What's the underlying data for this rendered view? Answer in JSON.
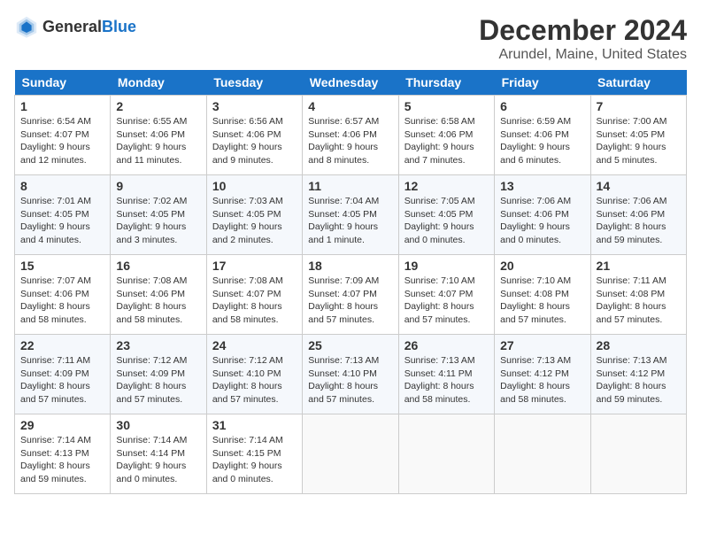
{
  "header": {
    "logo_general": "General",
    "logo_blue": "Blue",
    "month": "December 2024",
    "location": "Arundel, Maine, United States"
  },
  "weekdays": [
    "Sunday",
    "Monday",
    "Tuesday",
    "Wednesday",
    "Thursday",
    "Friday",
    "Saturday"
  ],
  "weeks": [
    [
      {
        "day": "1",
        "sunrise": "Sunrise: 6:54 AM",
        "sunset": "Sunset: 4:07 PM",
        "daylight": "Daylight: 9 hours and 12 minutes."
      },
      {
        "day": "2",
        "sunrise": "Sunrise: 6:55 AM",
        "sunset": "Sunset: 4:06 PM",
        "daylight": "Daylight: 9 hours and 11 minutes."
      },
      {
        "day": "3",
        "sunrise": "Sunrise: 6:56 AM",
        "sunset": "Sunset: 4:06 PM",
        "daylight": "Daylight: 9 hours and 9 minutes."
      },
      {
        "day": "4",
        "sunrise": "Sunrise: 6:57 AM",
        "sunset": "Sunset: 4:06 PM",
        "daylight": "Daylight: 9 hours and 8 minutes."
      },
      {
        "day": "5",
        "sunrise": "Sunrise: 6:58 AM",
        "sunset": "Sunset: 4:06 PM",
        "daylight": "Daylight: 9 hours and 7 minutes."
      },
      {
        "day": "6",
        "sunrise": "Sunrise: 6:59 AM",
        "sunset": "Sunset: 4:06 PM",
        "daylight": "Daylight: 9 hours and 6 minutes."
      },
      {
        "day": "7",
        "sunrise": "Sunrise: 7:00 AM",
        "sunset": "Sunset: 4:05 PM",
        "daylight": "Daylight: 9 hours and 5 minutes."
      }
    ],
    [
      {
        "day": "8",
        "sunrise": "Sunrise: 7:01 AM",
        "sunset": "Sunset: 4:05 PM",
        "daylight": "Daylight: 9 hours and 4 minutes."
      },
      {
        "day": "9",
        "sunrise": "Sunrise: 7:02 AM",
        "sunset": "Sunset: 4:05 PM",
        "daylight": "Daylight: 9 hours and 3 minutes."
      },
      {
        "day": "10",
        "sunrise": "Sunrise: 7:03 AM",
        "sunset": "Sunset: 4:05 PM",
        "daylight": "Daylight: 9 hours and 2 minutes."
      },
      {
        "day": "11",
        "sunrise": "Sunrise: 7:04 AM",
        "sunset": "Sunset: 4:05 PM",
        "daylight": "Daylight: 9 hours and 1 minute."
      },
      {
        "day": "12",
        "sunrise": "Sunrise: 7:05 AM",
        "sunset": "Sunset: 4:05 PM",
        "daylight": "Daylight: 9 hours and 0 minutes."
      },
      {
        "day": "13",
        "sunrise": "Sunrise: 7:06 AM",
        "sunset": "Sunset: 4:06 PM",
        "daylight": "Daylight: 9 hours and 0 minutes."
      },
      {
        "day": "14",
        "sunrise": "Sunrise: 7:06 AM",
        "sunset": "Sunset: 4:06 PM",
        "daylight": "Daylight: 8 hours and 59 minutes."
      }
    ],
    [
      {
        "day": "15",
        "sunrise": "Sunrise: 7:07 AM",
        "sunset": "Sunset: 4:06 PM",
        "daylight": "Daylight: 8 hours and 58 minutes."
      },
      {
        "day": "16",
        "sunrise": "Sunrise: 7:08 AM",
        "sunset": "Sunset: 4:06 PM",
        "daylight": "Daylight: 8 hours and 58 minutes."
      },
      {
        "day": "17",
        "sunrise": "Sunrise: 7:08 AM",
        "sunset": "Sunset: 4:07 PM",
        "daylight": "Daylight: 8 hours and 58 minutes."
      },
      {
        "day": "18",
        "sunrise": "Sunrise: 7:09 AM",
        "sunset": "Sunset: 4:07 PM",
        "daylight": "Daylight: 8 hours and 57 minutes."
      },
      {
        "day": "19",
        "sunrise": "Sunrise: 7:10 AM",
        "sunset": "Sunset: 4:07 PM",
        "daylight": "Daylight: 8 hours and 57 minutes."
      },
      {
        "day": "20",
        "sunrise": "Sunrise: 7:10 AM",
        "sunset": "Sunset: 4:08 PM",
        "daylight": "Daylight: 8 hours and 57 minutes."
      },
      {
        "day": "21",
        "sunrise": "Sunrise: 7:11 AM",
        "sunset": "Sunset: 4:08 PM",
        "daylight": "Daylight: 8 hours and 57 minutes."
      }
    ],
    [
      {
        "day": "22",
        "sunrise": "Sunrise: 7:11 AM",
        "sunset": "Sunset: 4:09 PM",
        "daylight": "Daylight: 8 hours and 57 minutes."
      },
      {
        "day": "23",
        "sunrise": "Sunrise: 7:12 AM",
        "sunset": "Sunset: 4:09 PM",
        "daylight": "Daylight: 8 hours and 57 minutes."
      },
      {
        "day": "24",
        "sunrise": "Sunrise: 7:12 AM",
        "sunset": "Sunset: 4:10 PM",
        "daylight": "Daylight: 8 hours and 57 minutes."
      },
      {
        "day": "25",
        "sunrise": "Sunrise: 7:13 AM",
        "sunset": "Sunset: 4:10 PM",
        "daylight": "Daylight: 8 hours and 57 minutes."
      },
      {
        "day": "26",
        "sunrise": "Sunrise: 7:13 AM",
        "sunset": "Sunset: 4:11 PM",
        "daylight": "Daylight: 8 hours and 58 minutes."
      },
      {
        "day": "27",
        "sunrise": "Sunrise: 7:13 AM",
        "sunset": "Sunset: 4:12 PM",
        "daylight": "Daylight: 8 hours and 58 minutes."
      },
      {
        "day": "28",
        "sunrise": "Sunrise: 7:13 AM",
        "sunset": "Sunset: 4:12 PM",
        "daylight": "Daylight: 8 hours and 59 minutes."
      }
    ],
    [
      {
        "day": "29",
        "sunrise": "Sunrise: 7:14 AM",
        "sunset": "Sunset: 4:13 PM",
        "daylight": "Daylight: 8 hours and 59 minutes."
      },
      {
        "day": "30",
        "sunrise": "Sunrise: 7:14 AM",
        "sunset": "Sunset: 4:14 PM",
        "daylight": "Daylight: 9 hours and 0 minutes."
      },
      {
        "day": "31",
        "sunrise": "Sunrise: 7:14 AM",
        "sunset": "Sunset: 4:15 PM",
        "daylight": "Daylight: 9 hours and 0 minutes."
      },
      null,
      null,
      null,
      null
    ]
  ]
}
